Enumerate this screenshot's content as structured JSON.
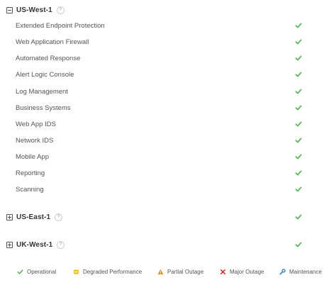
{
  "regions": [
    {
      "name": "US-West-1",
      "help": "?",
      "expanded": true,
      "services": [
        {
          "label": "Extended Endpoint Protection",
          "status": "Operational"
        },
        {
          "label": "Web Application Firewall",
          "status": "Operational"
        },
        {
          "label": "Automated Response",
          "status": "Operational"
        },
        {
          "label": "Alert Logic Console",
          "status": "Operational"
        },
        {
          "label": "Log Management",
          "status": "Operational"
        },
        {
          "label": "Business Systems",
          "status": "Operational"
        },
        {
          "label": "Web App IDS",
          "status": "Operational"
        },
        {
          "label": "Network IDS",
          "status": "Operational"
        },
        {
          "label": "Mobile App",
          "status": "Operational"
        },
        {
          "label": "Reporting",
          "status": "Operational"
        },
        {
          "label": "Scanning",
          "status": "Operational"
        }
      ]
    },
    {
      "name": "US-East-1",
      "help": "?",
      "expanded": false,
      "status": "Operational"
    },
    {
      "name": "UK-West-1",
      "help": "?",
      "expanded": false,
      "status": "Operational"
    }
  ],
  "legend": [
    {
      "label": "Operational",
      "icon": "check-icon",
      "color": "#5cb85c"
    },
    {
      "label": "Degraded Performance",
      "icon": "degraded-icon",
      "color": "#f0c419"
    },
    {
      "label": "Partial Outage",
      "icon": "warning-icon",
      "color": "#f0901c"
    },
    {
      "label": "Major Outage",
      "icon": "x-icon",
      "color": "#d9302c"
    },
    {
      "label": "Maintenance",
      "icon": "wrench-icon",
      "color": "#2f7fd3"
    }
  ],
  "colors": {
    "operational": "#5cb85c",
    "text": "#555555",
    "heading": "#333333"
  }
}
